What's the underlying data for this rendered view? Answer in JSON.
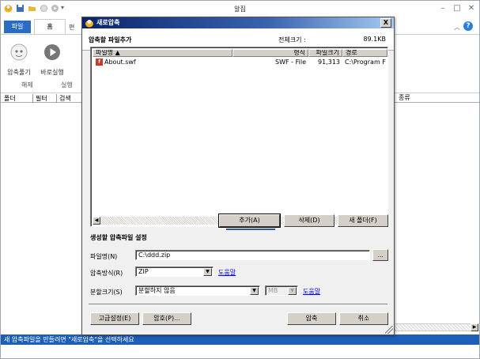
{
  "main_window": {
    "title": "알집",
    "ribbon_tabs": {
      "file": "파일",
      "home": "홈",
      "next": "편"
    },
    "ribbon_buttons": {
      "extract": "압축풀기",
      "run": "바로실행"
    },
    "ribbon_groups": {
      "extract": "해제",
      "run": "실행"
    },
    "filter_bar": {
      "folder": "폴더",
      "filter": "필터",
      "search": "검색"
    },
    "column_type": "종류",
    "status": "새 압축파일을 만들려면 \"새로압축\"을 선택하세요"
  },
  "dialog": {
    "title": "새로압축",
    "close": "X",
    "heading": "압축할 파일추가",
    "total_size_label": "전체크기 :",
    "total_size_value": "89.1KB",
    "columns": [
      "파일명 ▲",
      "형식",
      "파일크기",
      "경로"
    ],
    "files": [
      {
        "name": "About.swf",
        "type": "SWF - File",
        "size": "91,313",
        "path": "C:\\Program F"
      }
    ],
    "buttons": {
      "add": "추가(A)",
      "delete": "삭제(D)",
      "new_folder": "새 폴더(F)",
      "browse": "...",
      "advanced": "고급설정(E)",
      "password": "암호(P)...",
      "compress": "압축",
      "cancel": "취소"
    },
    "settings_heading": "생성할 압축파일 설정",
    "filename_label": "파일명(N)",
    "filename_value": "C:\\ddd.zip",
    "method_label": "압축방식(R)",
    "method_value": "ZIP",
    "split_label": "분할크기(S)",
    "split_value": "분할하지 않음",
    "unit_value": "MB",
    "help_link": "도움말",
    "scroll_left": "◀",
    "scroll_right": "▶",
    "combo_arrow": "▼"
  },
  "colors": {
    "accent": "#2b6cc4",
    "status_bar": "#1d5fb8",
    "dialog_title_start": "#0a246a",
    "dialog_title_end": "#a6caf0"
  }
}
